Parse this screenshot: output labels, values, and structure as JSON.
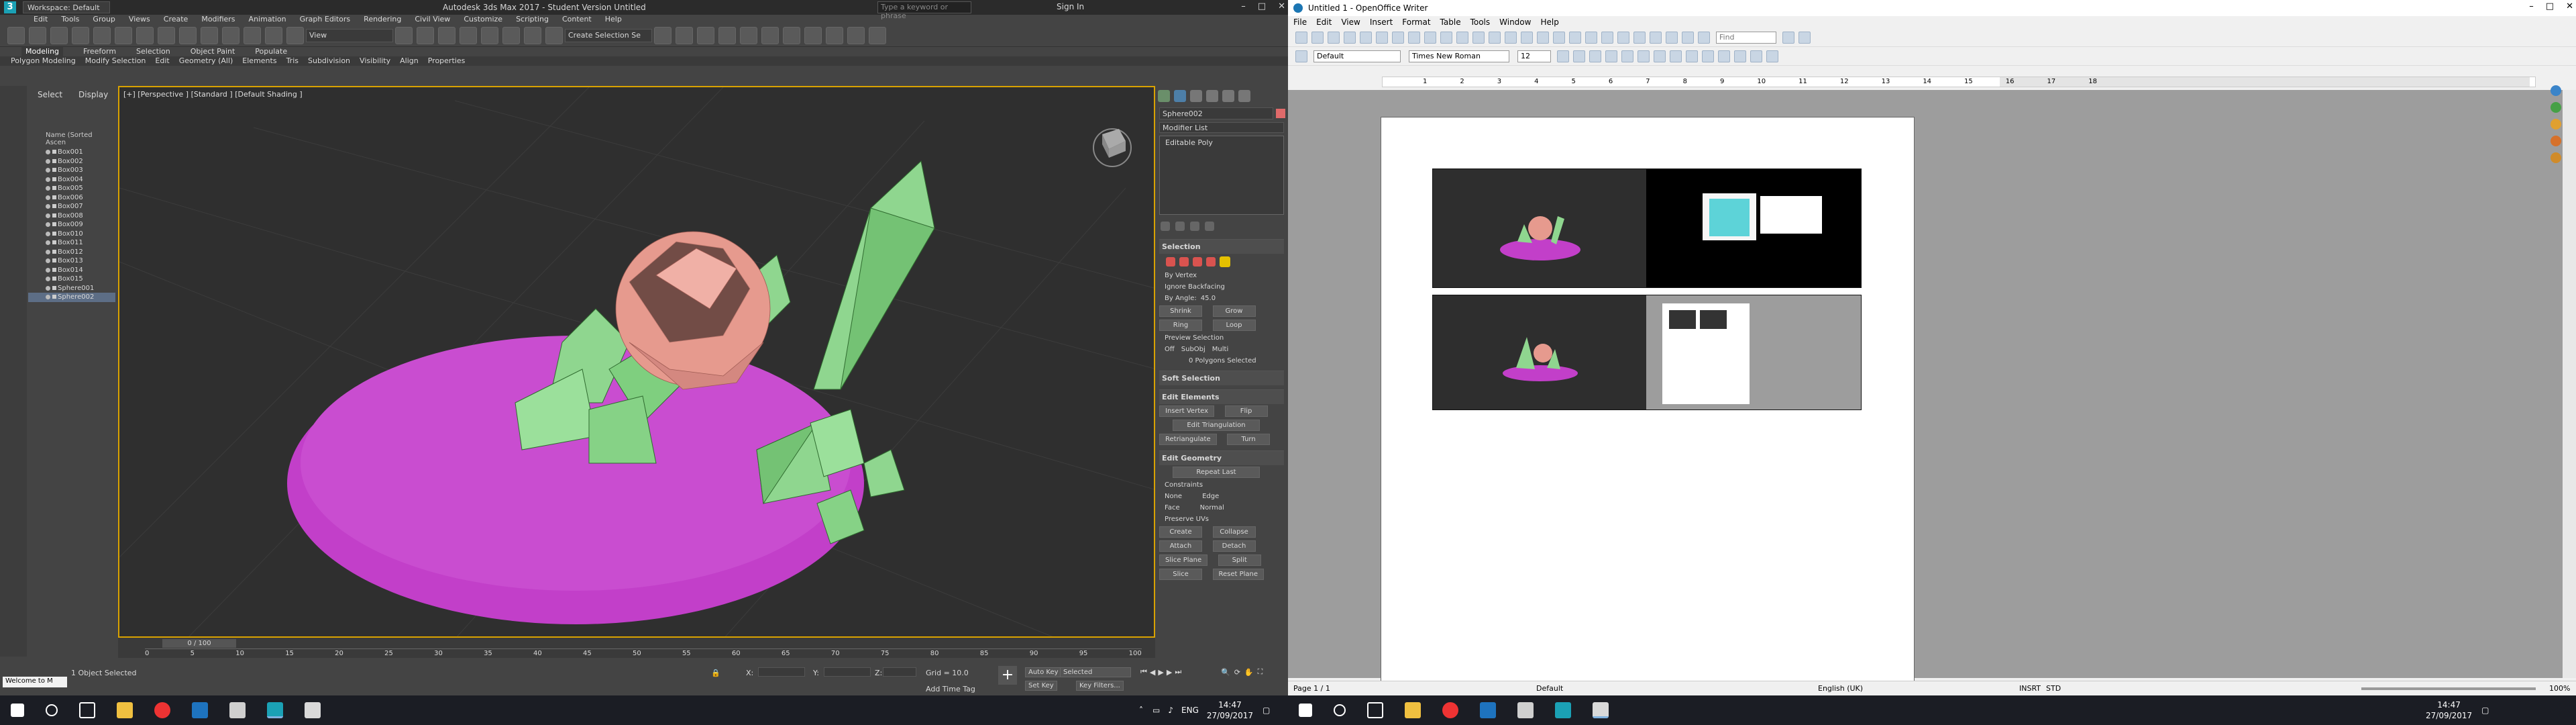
{
  "max": {
    "title": "Autodesk 3ds Max 2017 - Student Version    Untitled",
    "workspace": "Workspace: Default",
    "search_placeholder": "Type a keyword or phrase",
    "sign_in": "Sign In",
    "menu": [
      "Edit",
      "Tools",
      "Group",
      "Views",
      "Create",
      "Modifiers",
      "Animation",
      "Graph Editors",
      "Rendering",
      "Civil View",
      "Customize",
      "Scripting",
      "Content",
      "Help"
    ],
    "toolbar": {
      "view_select": "View",
      "selection_set": "Create Selection Se"
    },
    "ribbon_tabs": [
      "Modeling",
      "Freeform",
      "Selection",
      "Object Paint",
      "Populate"
    ],
    "ribbon_items": [
      "Polygon Modeling",
      "Modify Selection",
      "Edit",
      "Geometry (All)",
      "Elements",
      "Tris",
      "Subdivision",
      "Visibility",
      "Align",
      "Properties"
    ],
    "scene_explorer": {
      "tabs": [
        "Select",
        "Display"
      ],
      "header": "Name (Sorted Ascen",
      "items": [
        "Box001",
        "Box002",
        "Box003",
        "Box004",
        "Box005",
        "Box006",
        "Box007",
        "Box008",
        "Box009",
        "Box010",
        "Box011",
        "Box012",
        "Box013",
        "Box014",
        "Box015",
        "Sphere001",
        "Sphere002"
      ]
    },
    "viewport_label": "[+] [Perspective ] [Standard ] [Default Shading ]",
    "command_panel": {
      "object_name": "Sphere002",
      "modifier_list": "Modifier List",
      "stack_item": "Editable Poly",
      "selection_title": "Selection",
      "by_vertex": "By Vertex",
      "ignore_backfacing": "Ignore Backfacing",
      "by_angle": "By Angle:",
      "by_angle_value": "45.0",
      "shrink": "Shrink",
      "grow": "Grow",
      "ring": "Ring",
      "loop": "Loop",
      "preview_selection": "Preview Selection",
      "preview_opts": [
        "Off",
        "SubObj",
        "Multi"
      ],
      "polys_selected": "0 Polygons Selected",
      "soft_selection": "Soft Selection",
      "edit_elements": "Edit Elements",
      "insert_vertex": "Insert Vertex",
      "flip": "Flip",
      "edit_triangulation": "Edit Triangulation",
      "retriangulate": "Retriangulate",
      "turn": "Turn",
      "edit_geometry": "Edit Geometry",
      "repeat_last": "Repeat Last",
      "constraints": "Constraints",
      "constraint_opts": [
        "None",
        "Edge",
        "Face",
        "Normal"
      ],
      "preserve_uvs": "Preserve UVs",
      "create": "Create",
      "collapse": "Collapse",
      "attach": "Attach",
      "detach": "Detach",
      "slice_plane": "Slice Plane",
      "split": "Split",
      "slice": "Slice",
      "reset_plane": "Reset Plane"
    },
    "timeline": {
      "frame": "0 / 100",
      "ticks": [
        "0",
        "5",
        "10",
        "15",
        "20",
        "25",
        "30",
        "35",
        "40",
        "45",
        "50",
        "55",
        "60",
        "65",
        "70",
        "75",
        "80",
        "85",
        "90",
        "95",
        "100"
      ]
    },
    "status": {
      "script_listener": "Welcome to M",
      "selection": "1 Object Selected",
      "x_label": "X:",
      "y_label": "Y:",
      "z_label": "Z:",
      "grid": "Grid = 10.0",
      "add_time_tag": "Add Time Tag",
      "auto_key": "Auto Key",
      "auto_key_mode": "Selected",
      "set_key": "Set Key",
      "key_filters": "Key Filters..."
    },
    "colors": {
      "accent_active": "#d9a200",
      "ground": "#c040c8",
      "crystal": "#8fd68f",
      "sphere": "#e69a8e"
    }
  },
  "writer": {
    "title": "Untitled 1 - OpenOffice Writer",
    "menu": [
      "File",
      "Edit",
      "View",
      "Insert",
      "Format",
      "Table",
      "Tools",
      "Window",
      "Help"
    ],
    "find_placeholder": "Find",
    "style": "Default",
    "font": "Times New Roman",
    "size": "12",
    "ruler_ticks": [
      "1",
      "2",
      "3",
      "4",
      "5",
      "6",
      "7",
      "8",
      "9",
      "10",
      "11",
      "12",
      "13",
      "14",
      "15",
      "16",
      "17",
      "18"
    ],
    "status": {
      "page": "Page 1 / 1",
      "style": "Default",
      "language": "English (UK)",
      "insert": "INSRT",
      "mode": "STD",
      "zoom": "100%"
    }
  },
  "taskbar": {
    "tray_lang": "ENG",
    "time": "14:47",
    "date": "27/09/2017"
  }
}
